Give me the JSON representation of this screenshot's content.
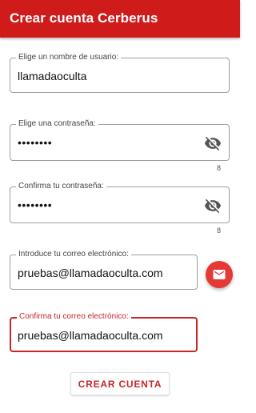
{
  "appbar": {
    "title": "Crear cuenta Cerberus"
  },
  "fields": {
    "username": {
      "label": "Elige un nombre de usuario:",
      "value": "llamadaoculta"
    },
    "password": {
      "label": "Elige una contraseña:",
      "value": "••••••••",
      "counter": "8",
      "toggle_icon": "visibility-off-icon"
    },
    "password_confirm": {
      "label": "Confirma tu contraseña:",
      "value": "••••••••",
      "counter": "8",
      "toggle_icon": "visibility-off-icon"
    },
    "email": {
      "label": "Introduce tu correo electrónico:",
      "value": "pruebas@llamadaoculta.com"
    },
    "email_confirm": {
      "label": "Confirma tu correo electrónico:",
      "value": "pruebas@llamadaoculta.com"
    }
  },
  "fab": {
    "icon": "mail-icon"
  },
  "actions": {
    "create_account": "CREAR CUENTA"
  },
  "colors": {
    "primary": "#d01b1b",
    "accent": "#e53935",
    "focus": "#c62828"
  }
}
